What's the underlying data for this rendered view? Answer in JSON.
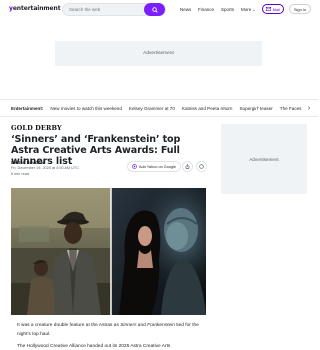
{
  "header": {
    "logo_y": "y",
    "logo_rest": "entertainment",
    "search_placeholder": "Search the web",
    "nav": [
      "News",
      "Finance",
      "Sports",
      "More"
    ],
    "mail_label": "Mail",
    "signin_label": "Sign in",
    "accent_color": "#7b1fff"
  },
  "ads": {
    "top_label": "Advertisement",
    "side_label": "Advertisement"
  },
  "trending": {
    "label": "Entertainment:",
    "items": [
      "New movies to watch this weekend",
      "Kelsey Grammer at 70",
      "Katniss and Peeta return",
      "Supergirl' teaser",
      "The Faces"
    ]
  },
  "article": {
    "source": "GOLD DERBY",
    "title": "‘Sinners’ and ‘Frankenstein’ top Astra Creative Arts Awards: Full winners list",
    "author": "Denton Davidson",
    "date": "Fri, December 19, 2025 at 4:50 AM UTC",
    "read_time": "6 min read",
    "add_google": "Add Yahoo on Google",
    "body1_a": "It was a creature double feature at the Astras as ",
    "body1_em1": "Sinners",
    "body1_b": " and ",
    "body1_em2": "Frankenstein",
    "body1_c": " tied for the night’s top haul.",
    "body2": "The Hollywood Creative Alliance handed out its 2025 Astra Creative Arts"
  }
}
